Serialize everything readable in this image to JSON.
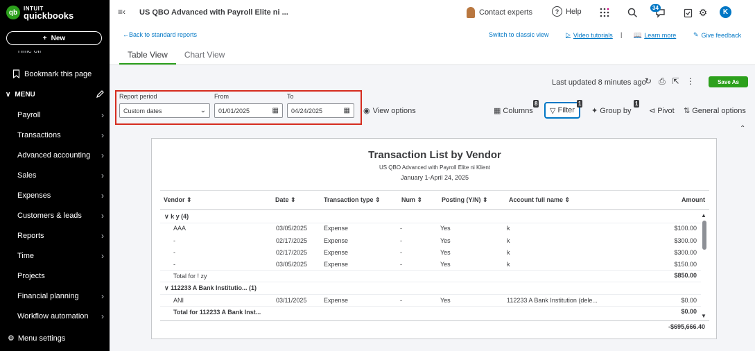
{
  "brand": {
    "intuit": "INTUIT",
    "name": "quickbooks",
    "mark": "qb"
  },
  "sidebar": {
    "new_label": "New",
    "cut_item": "Time off",
    "bookmark_label": "Bookmark this page",
    "menu_label": "MENU",
    "items": [
      {
        "label": "Payroll"
      },
      {
        "label": "Transactions"
      },
      {
        "label": "Advanced accounting"
      },
      {
        "label": "Sales"
      },
      {
        "label": "Expenses"
      },
      {
        "label": "Customers & leads"
      },
      {
        "label": "Reports"
      },
      {
        "label": "Time"
      },
      {
        "label": "Projects"
      },
      {
        "label": "Financial planning"
      },
      {
        "label": "Workflow automation"
      }
    ],
    "settings_label": "Menu settings"
  },
  "topbar": {
    "company": "US QBO Advanced with Payroll Elite ni ...",
    "contact": "Contact experts",
    "help": "Help",
    "notifications": "34",
    "user_initial": "K"
  },
  "subheader": {
    "back": "Back to standard reports",
    "switch": "Switch to classic view",
    "video": "Video tutorials",
    "learn": "Learn more",
    "feedback": "Give feedback",
    "tabs": [
      "Table View",
      "Chart View"
    ]
  },
  "controls": {
    "last_updated": "Last updated 8 minutes ago",
    "save_as": "Save As",
    "report_period_label": "Report period",
    "report_period_value": "Custom dates",
    "from_label": "From",
    "from_value": "01/01/2025",
    "to_label": "To",
    "to_value": "04/24/2025",
    "view_options": "View options",
    "columns": "Columns",
    "columns_count": "8",
    "filter": "Filter",
    "filter_count": "1",
    "group_by": "Group by",
    "group_count": "1",
    "pivot": "Pivot",
    "general_options": "General options"
  },
  "report": {
    "title": "Transaction List by Vendor",
    "subtitle": "US QBO Advanced with Payroll Elite ni Klient",
    "date_range": "January 1-April 24, 2025",
    "columns": [
      "Vendor",
      "Date",
      "Transaction type",
      "Num",
      "Posting (Y/N)",
      "Account full name",
      "Amount"
    ],
    "group1": {
      "header": "k   y (4)",
      "rows": [
        {
          "vendor": "AAA",
          "date": "03/05/2025",
          "type": "Expense",
          "num": "-",
          "posting": "Yes",
          "account": "k",
          "amount": "$100.00"
        },
        {
          "vendor": "-",
          "date": "02/17/2025",
          "type": "Expense",
          "num": "-",
          "posting": "Yes",
          "account": "k",
          "amount": "$300.00"
        },
        {
          "vendor": "-",
          "date": "02/17/2025",
          "type": "Expense",
          "num": "-",
          "posting": "Yes",
          "account": "k",
          "amount": "$300.00"
        },
        {
          "vendor": "-",
          "date": "03/05/2025",
          "type": "Expense",
          "num": "-",
          "posting": "Yes",
          "account": "k",
          "amount": "$150.00"
        }
      ],
      "total_label": "Total for !    zy",
      "total": "$850.00"
    },
    "group2": {
      "header": "112233 A Bank Institutio... (1)",
      "rows": [
        {
          "vendor": "ANI",
          "date": "03/11/2025",
          "type": "Expense",
          "num": "-",
          "posting": "Yes",
          "account": "112233 A Bank Institution (dele...",
          "amount": "$0.00"
        }
      ],
      "total_label": "Total for 112233 A Bank Inst...",
      "total": "$0.00"
    },
    "grand_total": "-$695,666.40"
  }
}
